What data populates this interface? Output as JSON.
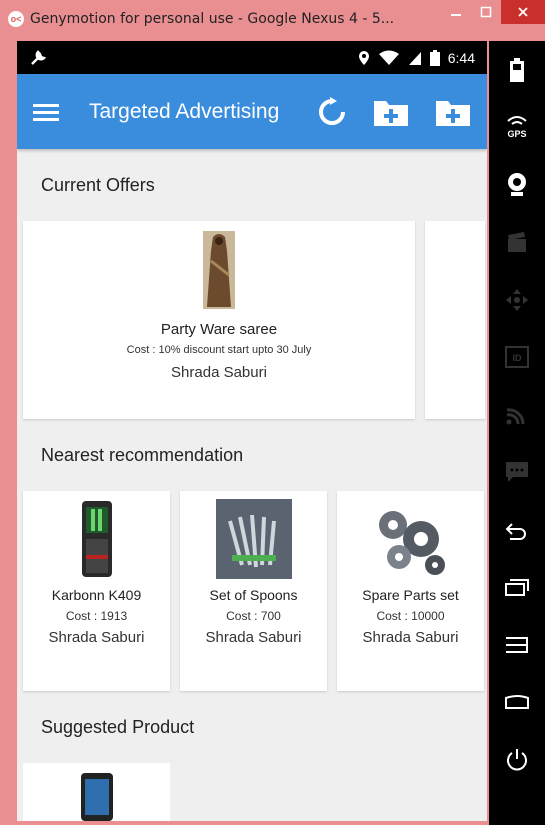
{
  "window": {
    "title": "Genymotion for personal use - Google Nexus 4 - 5...",
    "logo_text": "o<"
  },
  "statusbar": {
    "time": "6:44"
  },
  "appbar": {
    "title": "Targeted Advertising"
  },
  "sections": {
    "current_offers": "Current Offers",
    "nearest": "Nearest recommendation",
    "suggested": "Suggested Product"
  },
  "offers": [
    {
      "name": "Party Ware saree",
      "cost": "Cost : 10% discount start upto 30 July",
      "seller": "Shrada Saburi"
    }
  ],
  "recommendations": [
    {
      "name": "Karbonn K409",
      "cost": "Cost : 1913",
      "seller": "Shrada Saburi"
    },
    {
      "name": "Set of Spoons",
      "cost": "Cost : 700",
      "seller": "Shrada Saburi"
    },
    {
      "name": "Spare Parts set",
      "cost": "Cost : 10000",
      "seller": "Shrada Saburi"
    }
  ],
  "sidebar": {
    "gps_label": "GPS",
    "id_label": "ID"
  },
  "colors": {
    "appbar": "#3a8ddc",
    "frame": "#e98f92",
    "close": "#c9302c"
  }
}
